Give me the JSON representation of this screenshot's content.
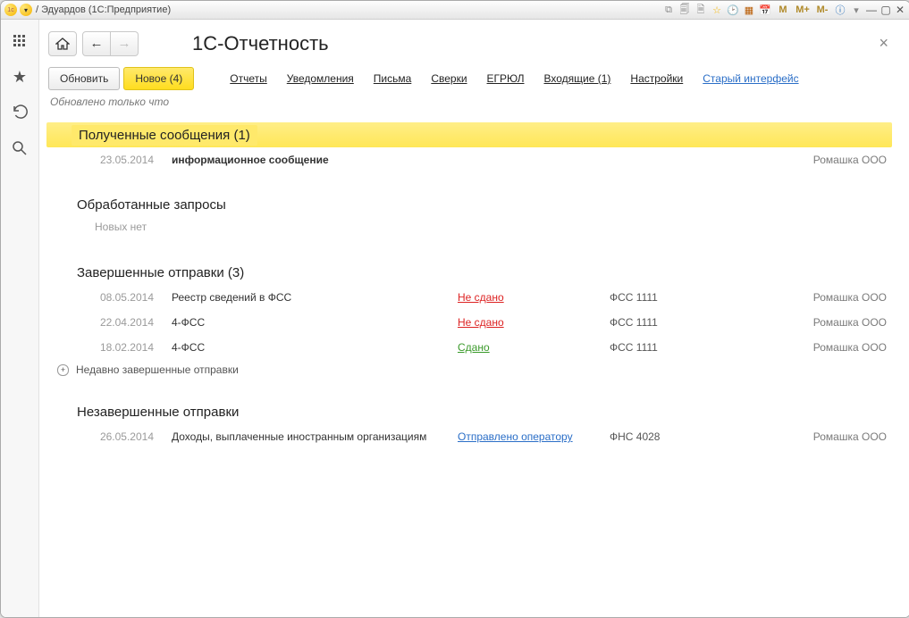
{
  "titlebar": {
    "path": "/ Эдуардов  (1С:Предприятие)",
    "m_buttons": [
      "M",
      "M+",
      "M-"
    ]
  },
  "page": {
    "title": "1С-Отчетность"
  },
  "toolbar": {
    "refresh_label": "Обновить",
    "new_label": "Новое (4)"
  },
  "tabs": {
    "reports": "Отчеты",
    "notifications": "Уведомления",
    "letters": "Письма",
    "reconcil": "Сверки",
    "egrul": "ЕГРЮЛ",
    "incoming": "Входящие (1)",
    "settings": "Настройки",
    "old_ui": "Старый интерфейс"
  },
  "status_line": "Обновлено только что",
  "sections": {
    "received": {
      "title": "Полученные сообщения (1)",
      "rows": [
        {
          "date": "23.05.2014",
          "desc": "информационное сообщение",
          "company": "Ромашка ООО"
        }
      ]
    },
    "processed": {
      "title": "Обработанные запросы",
      "empty_text": "Новых нет"
    },
    "completed": {
      "title": "Завершенные отправки (3)",
      "rows": [
        {
          "date": "08.05.2014",
          "desc": "Реестр сведений в ФСС",
          "status": "Не сдано",
          "status_class": "red",
          "code": "ФСС 1111",
          "company": "Ромашка ООО"
        },
        {
          "date": "22.04.2014",
          "desc": "4-ФСС",
          "status": "Не сдано",
          "status_class": "red",
          "code": "ФСС 1111",
          "company": "Ромашка ООО"
        },
        {
          "date": "18.02.2014",
          "desc": "4-ФСС",
          "status": "Сдано",
          "status_class": "green",
          "code": "ФСС 1111",
          "company": "Ромашка ООО"
        }
      ],
      "expand_label": "Недавно завершенные отправки"
    },
    "pending": {
      "title": "Незавершенные отправки",
      "rows": [
        {
          "date": "26.05.2014",
          "desc": "Доходы, выплаченные иностранным организациям",
          "status": "Отправлено оператору",
          "status_class": "blue",
          "code": "ФНС 4028",
          "company": "Ромашка ООО"
        }
      ]
    }
  }
}
